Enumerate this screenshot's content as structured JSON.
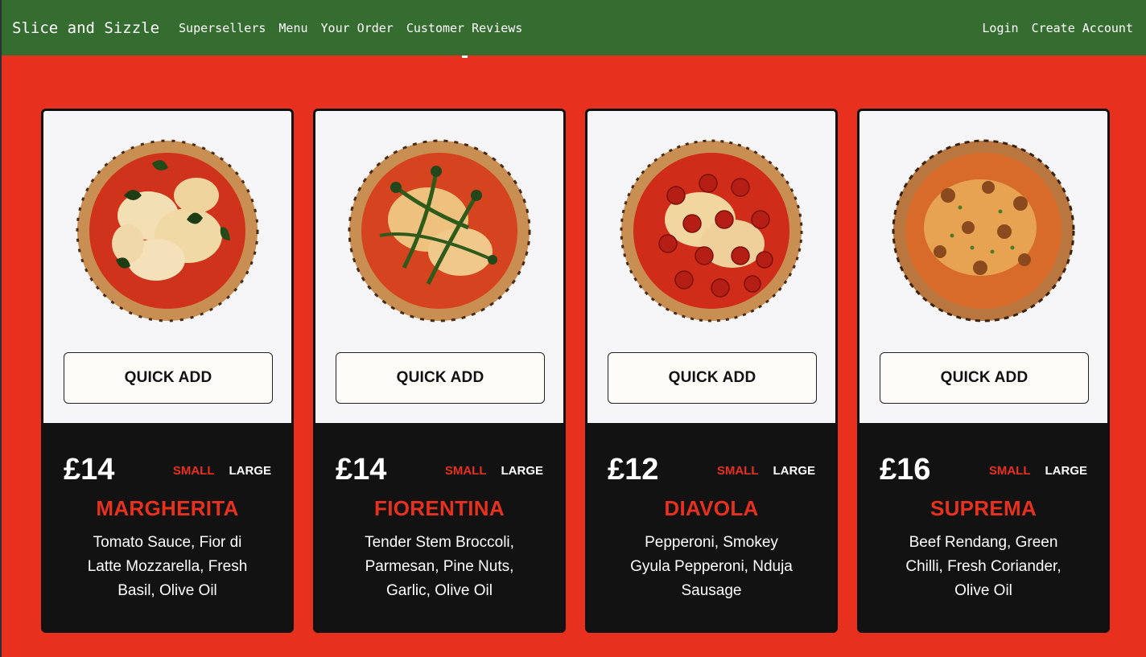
{
  "nav": {
    "brand": "Slice and Sizzle",
    "links": [
      "Supersellers",
      "Menu",
      "Your Order",
      "Customer Reviews"
    ],
    "login": "Login",
    "create_account": "Create Account"
  },
  "colors": {
    "background": "#e8301f",
    "navbar": "#356c2f",
    "card_bottom": "#121212",
    "card_top": "#f6f6f8",
    "accent": "#e8301f"
  },
  "cards": [
    {
      "image_icon": "margherita-pizza-image",
      "quick_add": "QUICK ADD",
      "price": "£14",
      "size_small": "SMALL",
      "size_large": "LARGE",
      "name": "MARGHERITA",
      "description": "Tomato Sauce, Fior di Latte Mozzarella, Fresh Basil, Olive Oil"
    },
    {
      "image_icon": "fiorentina-pizza-image",
      "quick_add": "QUICK ADD",
      "price": "£14",
      "size_small": "SMALL",
      "size_large": "LARGE",
      "name": "FIORENTINA",
      "description": "Tender Stem Broccoli, Parmesan, Pine Nuts, Garlic, Olive Oil"
    },
    {
      "image_icon": "diavola-pizza-image",
      "quick_add": "QUICK ADD",
      "price": "£12",
      "size_small": "SMALL",
      "size_large": "LARGE",
      "name": "DIAVOLA",
      "description": "Pepperoni, Smokey Gyula Pepperoni, Nduja Sausage"
    },
    {
      "image_icon": "suprema-pizza-image",
      "quick_add": "QUICK ADD",
      "price": "£16",
      "size_small": "SMALL",
      "size_large": "LARGE",
      "name": "SUPREMA",
      "description": "Beef Rendang, Green Chilli, Fresh Coriander, Olive Oil"
    }
  ]
}
